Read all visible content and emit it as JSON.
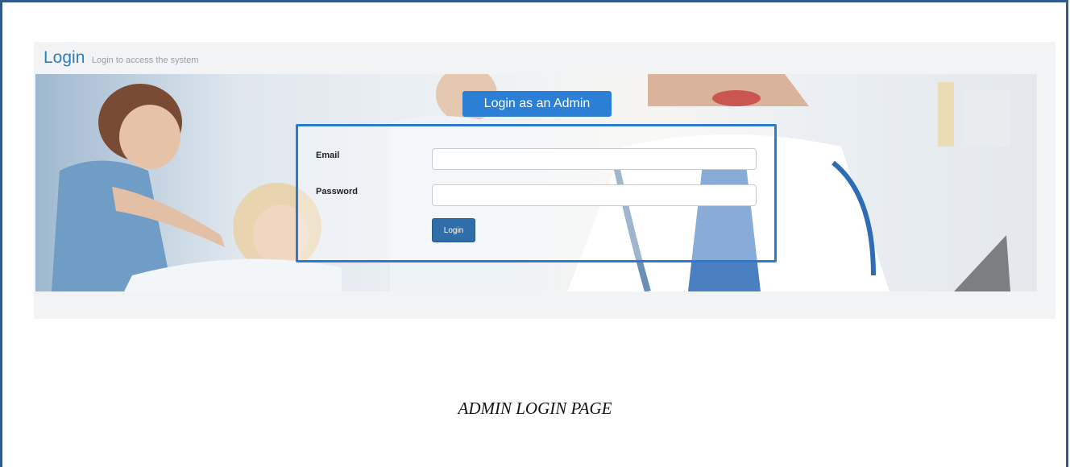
{
  "header": {
    "title": "Login",
    "subtitle": "Login to access the system"
  },
  "login_panel": {
    "mode_button_label": "Login as an Admin",
    "email_label": "Email",
    "email_value": "",
    "password_label": "Password",
    "password_value": "",
    "submit_label": "Login"
  },
  "caption": "ADMIN LOGIN PAGE",
  "colors": {
    "accent": "#2b7fd4",
    "title": "#2a7fc4",
    "frame": "#2f5a8a",
    "submit": "#2f6ea8"
  }
}
